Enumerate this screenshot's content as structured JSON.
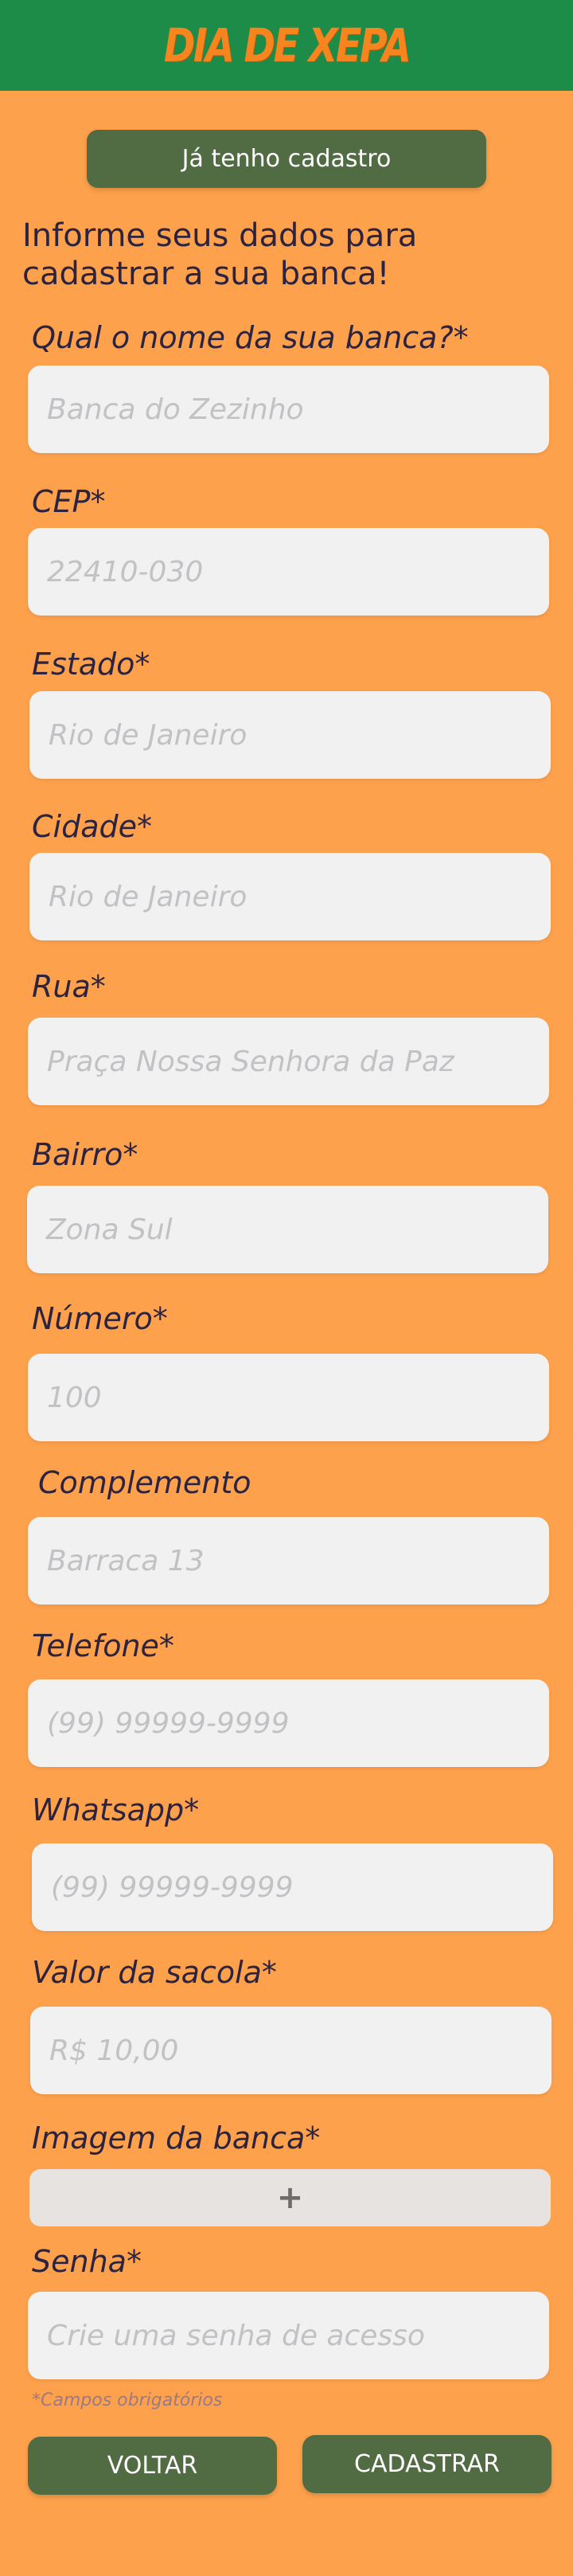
{
  "header": {
    "logo_text": "DIA DE XEPA"
  },
  "login_button": "Já tenho cadastro",
  "intro": "Informe seus dados para cadastrar a sua banca!",
  "fields": [
    {
      "label": "Qual o nome da sua banca?*",
      "placeholder": "Banca do Zezinho"
    },
    {
      "label": "CEP*",
      "placeholder": "22410-030"
    },
    {
      "label": "Estado*",
      "placeholder": "Rio de Janeiro"
    },
    {
      "label": "Cidade*",
      "placeholder": "Rio de Janeiro"
    },
    {
      "label": "Rua*",
      "placeholder": "Praça Nossa Senhora da Paz"
    },
    {
      "label": "Bairro*",
      "placeholder": "Zona Sul"
    },
    {
      "label": "Número*",
      "placeholder": "100"
    },
    {
      "label": "Complemento",
      "placeholder": "Barraca 13"
    },
    {
      "label": "Telefone*",
      "placeholder": "(99) 99999-9999"
    },
    {
      "label": "Whatsapp*",
      "placeholder": "(99) 99999-9999"
    },
    {
      "label": "Valor da sacola*",
      "placeholder": "R$ 10,00"
    }
  ],
  "image_field": {
    "label": "Imagem da banca*",
    "button_symbol": "+"
  },
  "password_field": {
    "label": "Senha*",
    "placeholder": "Crie uma senha de acesso"
  },
  "required_note": "*Campos obrigatórios",
  "buttons": {
    "back": "VOLTAR",
    "submit": "CADASTRAR"
  },
  "colors": {
    "header": "#1c8c48",
    "background": "#fda14c",
    "button": "#516b43",
    "logo": "#f6841f"
  }
}
